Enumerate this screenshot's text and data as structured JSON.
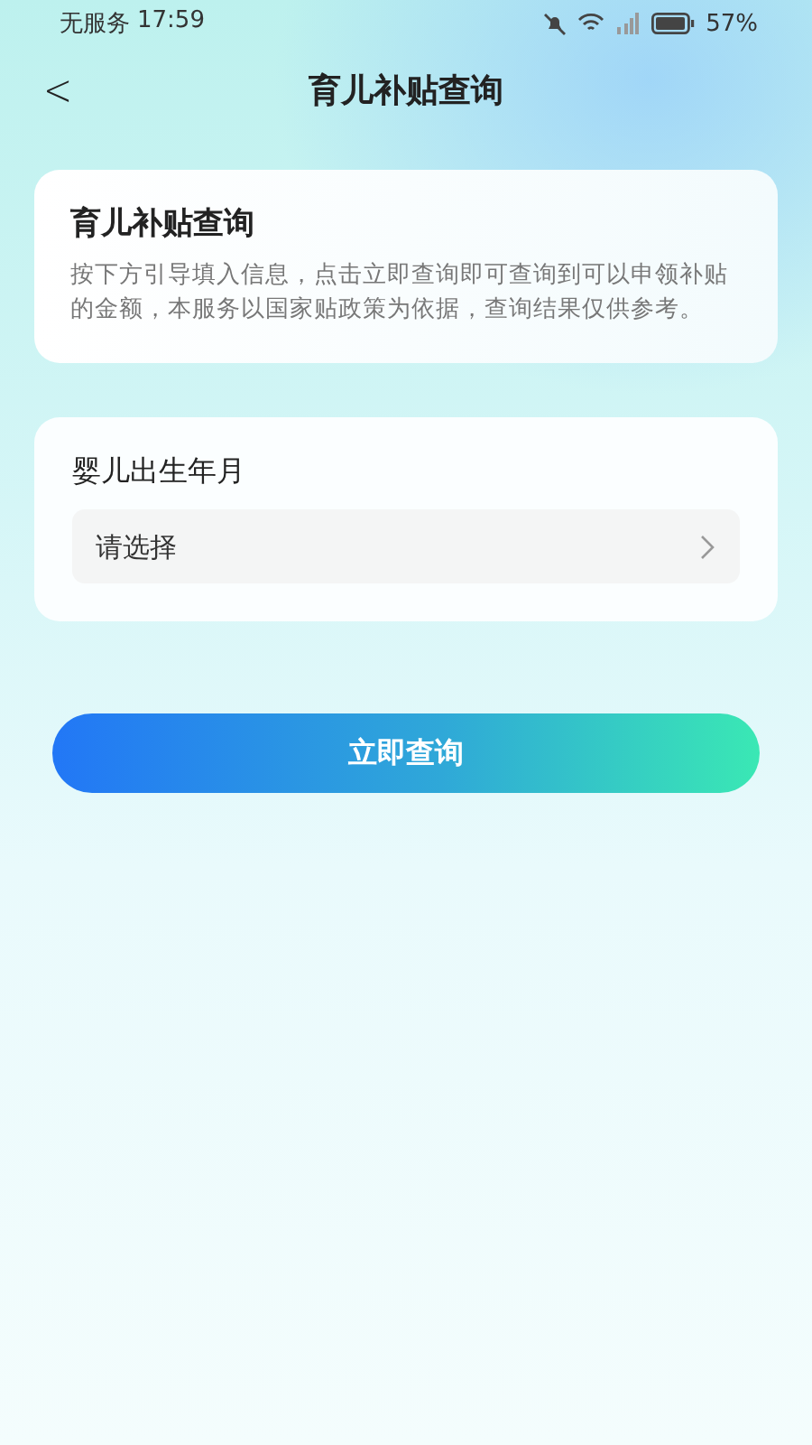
{
  "status_bar": {
    "carrier": "无服务",
    "time": "17:59",
    "battery_percent": "57%"
  },
  "nav_bar": {
    "back": "<",
    "title": "育儿补贴查询"
  },
  "info_card": {
    "title": "育儿补贴查询",
    "description": "按下方引导填入信息，点击立即查询即可查询到可以申领补贴的金额，本服务以国家贴政策为依据，查询结果仅供参考。"
  },
  "form_card": {
    "label": "婴儿出生年月",
    "field": {
      "placeholder": "请选择"
    }
  },
  "submit_button": {
    "label": "立即查询"
  }
}
